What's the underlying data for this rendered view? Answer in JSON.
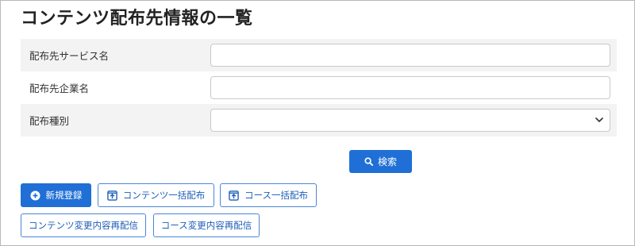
{
  "page": {
    "title": "コンテンツ配布先情報の一覧"
  },
  "form": {
    "service_name": {
      "label": "配布先サービス名",
      "value": ""
    },
    "company_name": {
      "label": "配布先企業名",
      "value": ""
    },
    "distribution_type": {
      "label": "配布種別",
      "selected": ""
    }
  },
  "actions": {
    "search_label": "検索",
    "new_register_label": "新規登録",
    "bulk_content_label": "コンテンツ一括配布",
    "bulk_course_label": "コース一括配布",
    "content_redistribute_label": "コンテンツ変更内容再配信",
    "course_redistribute_label": "コース変更内容再配信"
  },
  "colors": {
    "primary": "#1f6fd6",
    "row_shade": "#f3f3f3",
    "outline_text": "#1f5fb8"
  },
  "icons": {
    "search": "magnifier-icon",
    "new": "plus-circle-icon",
    "bulk": "upload-box-icon"
  }
}
